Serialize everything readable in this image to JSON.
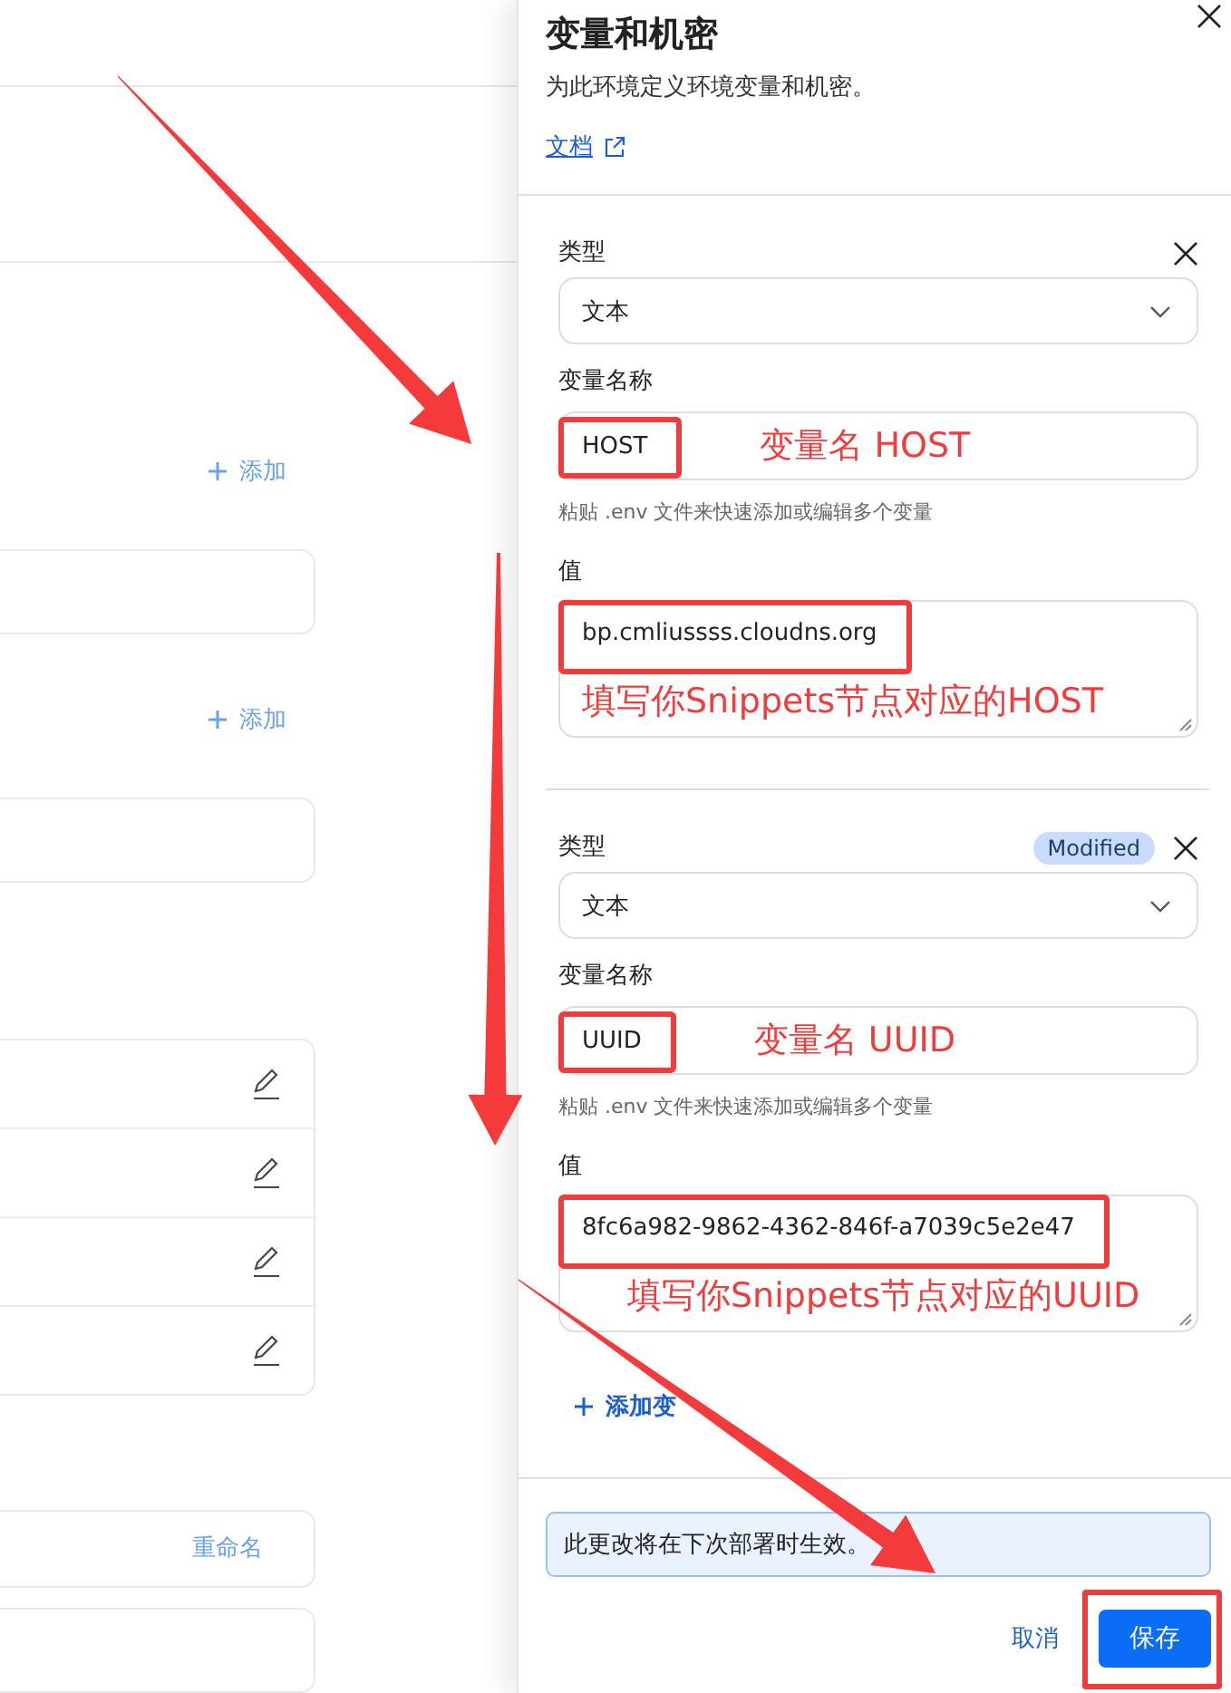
{
  "background_page": {
    "add_actions": [
      "添加",
      "添加"
    ],
    "rename_action": "重命名"
  },
  "drawer": {
    "title": "变量和机密",
    "description": "为此环境定义环境变量和机密。",
    "docs_link": "文档",
    "variables": [
      {
        "type_label": "类型",
        "type_value": "文本",
        "name_label": "变量名称",
        "name_value": "HOST",
        "name_highlighted": true,
        "name_note": "变量名 HOST",
        "hint_text": "粘贴 .env 文件来快速添加或编辑多个变量",
        "value_label": "值",
        "value": "bp.cmliussss.cloudns.org",
        "value_highlighted": true,
        "value_note": "填写你Snippets节点对应的HOST"
      },
      {
        "type_label": "类型",
        "badge": "Modified",
        "type_value": "文本",
        "name_label": "变量名称",
        "name_value": "UUID",
        "name_highlighted": true,
        "name_note": "变量名 UUID",
        "hint_text": "粘贴 .env 文件来快速添加或编辑多个变量",
        "value_label": "值",
        "value": "8fc6a982-9862-4362-846f-a7039c5e2e47",
        "value_highlighted": true,
        "value_note": "填写你Snippets节点对应的UUID"
      }
    ],
    "add_variable": "添加变",
    "notice": "此更改将在下次部署时生效。",
    "cancel": "取消",
    "save": "保存",
    "save_highlighted": true
  }
}
